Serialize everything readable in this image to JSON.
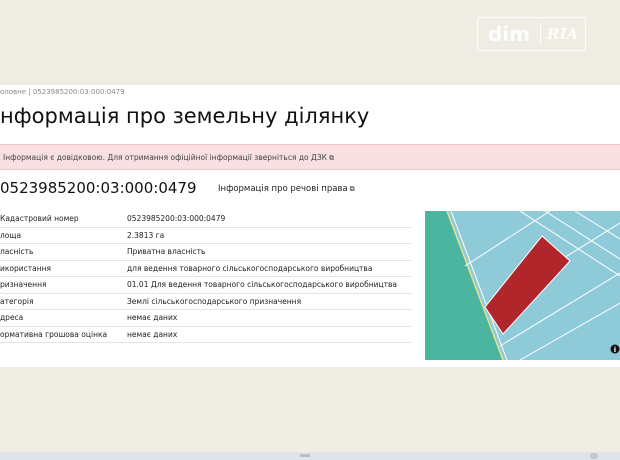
{
  "logo": {
    "left": "dim",
    "right": "RIA"
  },
  "breadcrumb": "оловне  |  0523985200:03:000:0479",
  "title": "нформація про земельну ділянку",
  "alert": {
    "text": "Інформація є довідковою. Для отримання офіційної інформації зверніться до ",
    "link": "ДЗК"
  },
  "cadastral_number": "0523985200:03:000:0479",
  "rights_link": "Інформація про речові права",
  "rows": [
    {
      "key": "Кадастровий номер",
      "value": "0523985200:03:000:0479"
    },
    {
      "key": "лоща",
      "value": "2.3813 га"
    },
    {
      "key": "ласність",
      "value": "Приватна власність"
    },
    {
      "key": "икористання",
      "value": "для ведення товарного сільськогосподарського виробництва"
    },
    {
      "key": "ризначення",
      "value": "01.01 Для ведення товарного сільськогосподарського виробництва"
    },
    {
      "key": "атегорія",
      "value": "Землі сільськогосподарського призначення"
    },
    {
      "key": "дреса",
      "value": "немає даних"
    },
    {
      "key": "ормативна грошова оцінка",
      "value": "немає даних"
    }
  ],
  "map": {
    "info_icon": "i"
  },
  "colors": {
    "parcel": "#b0262b",
    "water": "#8fcad9",
    "green": "#4bb5a0",
    "alert_bg": "#f7dfe2"
  }
}
